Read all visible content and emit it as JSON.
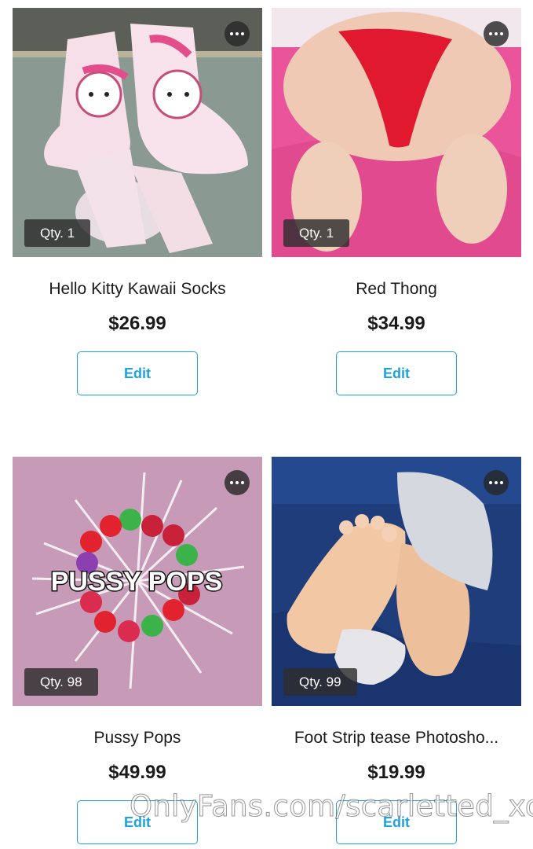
{
  "products": [
    {
      "title": "Hello Kitty Kawaii Socks",
      "price": "$26.99",
      "qty": "Qty. 1",
      "edit": "Edit",
      "scene": "socks"
    },
    {
      "title": "Red Thong",
      "price": "$34.99",
      "qty": "Qty. 1",
      "edit": "Edit",
      "scene": "thong"
    },
    {
      "title": "Pussy Pops",
      "price": "$49.99",
      "qty": "Qty. 98",
      "edit": "Edit",
      "scene": "lollipops",
      "overlay_text": "PUSSY POPS"
    },
    {
      "title": "Foot Strip tease Photosho...",
      "price": "$19.99",
      "qty": "Qty. 99",
      "edit": "Edit",
      "scene": "foot"
    }
  ],
  "watermark": "OnlyFans.com/scarletted_xo",
  "icons": {
    "more": "more-horizontal-icon"
  },
  "colors": {
    "accent": "#1fa1da",
    "badge_bg": "#2d2d2d"
  }
}
